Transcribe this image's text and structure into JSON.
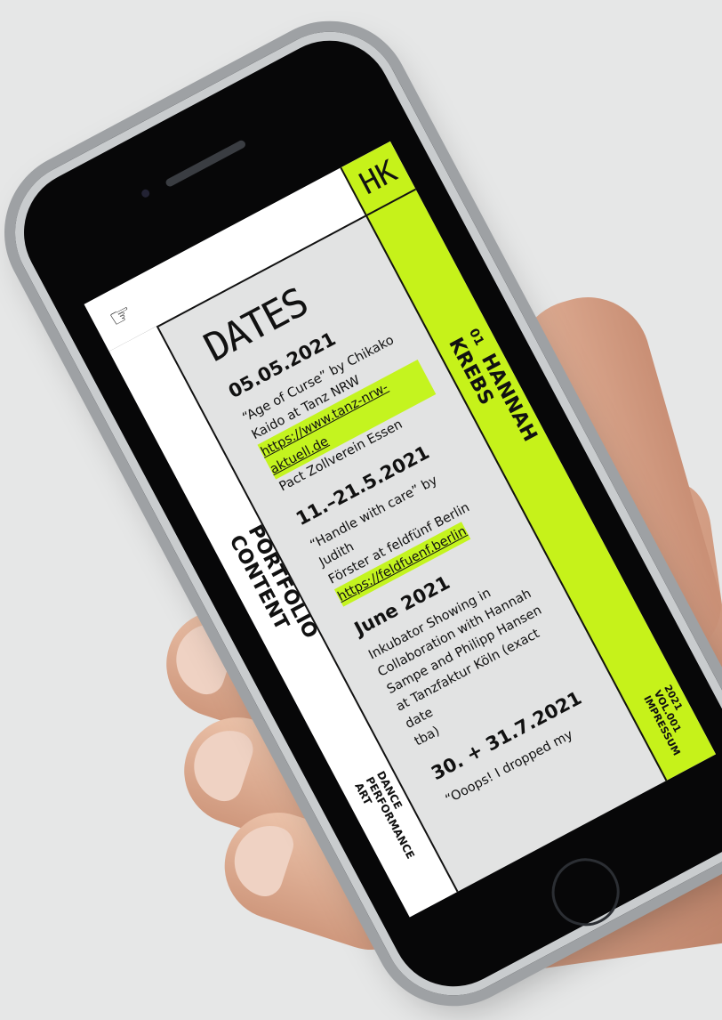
{
  "app": {
    "logo": "HK",
    "nav_icon": "pointing-hand-icon"
  },
  "page": {
    "title": "DATES"
  },
  "events": [
    {
      "date": "05.05.2021",
      "lines": [
        "“Age of Curse” by Chikako",
        "Kaido at Tanz NRW"
      ],
      "link": "https://www.tanz-nrw-aktuell.de",
      "extra": "Pact Zollverein  Essen"
    },
    {
      "date": "11.–21.5.2021",
      "lines": [
        "“Handle with care” by Judith",
        "Förster at feldfünf Berlin"
      ],
      "link": "https://feldfuenf.berlin",
      "extra": ""
    },
    {
      "date": "June 2021",
      "lines": [
        "Inkubator Showing in",
        "Collaboration with Hannah",
        "Sampe and Philipp Hansen",
        "at Tanzfaktur Köln (exact date",
        "tba)"
      ],
      "link": "",
      "extra": ""
    },
    {
      "date": "30. + 31.7.2021",
      "lines": [
        "“Ooops! I dropped my"
      ],
      "link": "",
      "extra": ""
    }
  ],
  "sidebar": {
    "number": "01",
    "name_line1": "HANNAH",
    "name_line2": "KREBS",
    "meta_line1": "2021",
    "meta_line2": "VOL.001",
    "meta_line3": "IMPRESSUM"
  },
  "left_strip": {
    "label_line1": "PORTFOLIO",
    "label_line2": "CONTENT",
    "tag_line1": "DANCE",
    "tag_line2": "PERFORMANCE",
    "tag_line3": "ART"
  },
  "colors": {
    "accent": "#c6f21a",
    "screen_bg": "#e2e3e3",
    "background": "#e6e7e7"
  }
}
